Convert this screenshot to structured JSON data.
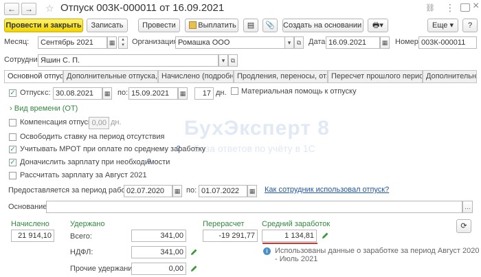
{
  "window": {
    "title": "Отпуск 003К-000011 от 16.09.2021",
    "nav_back": "←",
    "nav_forward": "→",
    "star": "☆",
    "link_icon": "🔗",
    "more": "⋮",
    "close": "×"
  },
  "toolbar": {
    "post_close": "Провести и закрыть",
    "save": "Записать",
    "post": "Провести",
    "pay": "Выплатить",
    "create_based": "Создать на основании",
    "more": "Еще",
    "help": "?"
  },
  "header": {
    "month_label": "Месяц:",
    "month_value": "Сентябрь 2021",
    "org_label": "Организация:",
    "org_value": "Ромашка ООО",
    "date_label": "Дата:",
    "date_value": "16.09.2021",
    "number_label": "Номер:",
    "number_value": "003К-000011",
    "employee_label": "Сотрудник:",
    "employee_value": "Яшин С. П."
  },
  "tabs": [
    {
      "label": "Основной отпуск"
    },
    {
      "label": "Дополнительные отпуска, ..."
    },
    {
      "label": "Начислено (подробно)"
    },
    {
      "label": "Продления, переносы, отз..."
    },
    {
      "label": "Пересчет прошлого периода"
    },
    {
      "label": "Дополнительно"
    }
  ],
  "main": {
    "vacation_label": "Отпуск",
    "from_label": "с:",
    "from_value": "30.08.2021",
    "to_label": "по:",
    "to_value": "15.09.2021",
    "days_value": "17",
    "days_unit": "дн.",
    "aid_label": "Материальная помощь к отпуску",
    "time_type": "Вид времени (ОТ)",
    "compensation_label": "Компенсация отпуска",
    "compensation_value": "0,00",
    "compensation_unit": "дн.",
    "release_rate": "Освободить ставку на период отсутствия",
    "mrot": "Учитывать МРОТ при оплате по среднему заработку",
    "additional_pay": "Доначислить зарплату при необходимости",
    "calc_salary": "Рассчитать зарплату за Август 2021",
    "period_label": "Предоставляется за период работы с:",
    "period_from": "02.07.2020",
    "period_to_label": "по:",
    "period_to": "01.07.2022",
    "usage_link": "Как сотрудник использовал отпуск?",
    "basis_label": "Основание:",
    "basis_value": "",
    "q": "?"
  },
  "totals": {
    "accrued_label": "Начислено",
    "accrued_value": "21 914,10",
    "withheld_label": "Удержано",
    "total_label": "Всего:",
    "total_value": "341,00",
    "ndfl_label": "НДФЛ:",
    "ndfl_value": "341,00",
    "other_label": "Прочие удержания:",
    "other_value": "0,00",
    "recalc_label": "Перерасчет",
    "recalc_value": "-19 291,77",
    "avg_label": "Средний заработок",
    "avg_value": "1 134,81",
    "info_text_1": "Использованы данные о заработке за период Август 2020",
    "info_text_2": "- Июль 2021"
  },
  "watermark": {
    "line1": "БухЭксперт 8",
    "line2": "База ответов по учёту в 1С"
  },
  "colors": {
    "accent_yellow": "#f2d600",
    "label_green": "#2f8a3c",
    "link_blue": "#1e56a8",
    "underline_red": "#d9302c"
  }
}
